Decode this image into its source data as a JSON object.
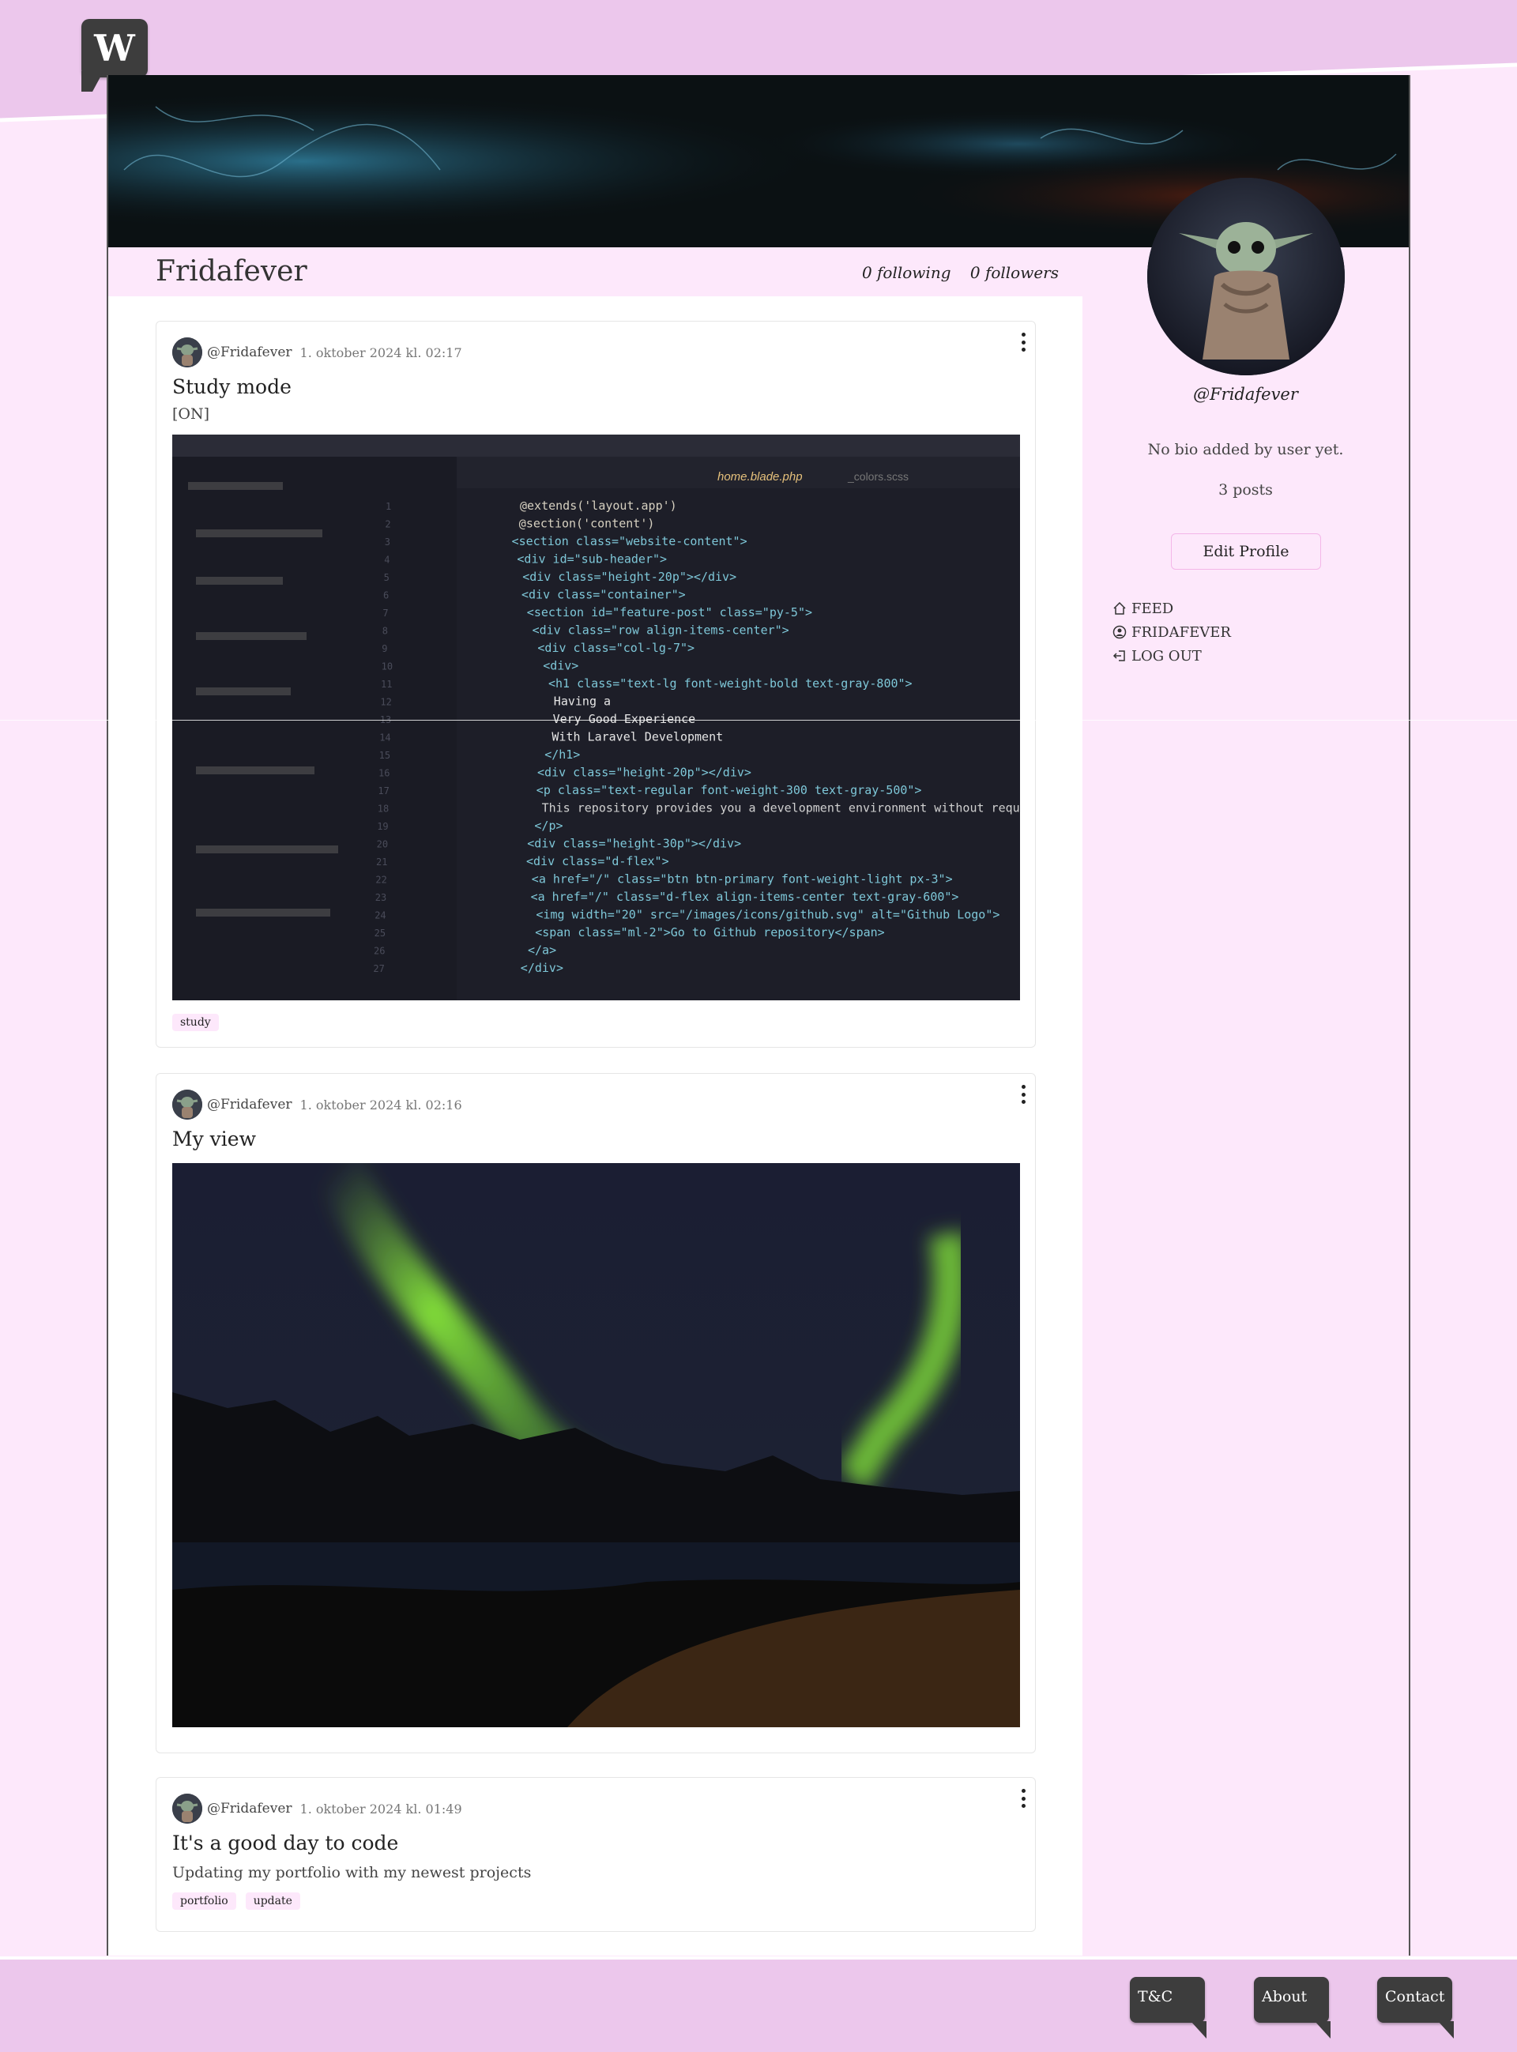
{
  "brand": {
    "logo_letter": "W"
  },
  "profile": {
    "name": "Fridafever",
    "following": "0 following",
    "followers": "0 followers",
    "handle": "@Fridafever",
    "bio": "No bio added by user yet.",
    "post_count": "3 posts",
    "edit_label": "Edit Profile"
  },
  "nav": {
    "feed": "FEED",
    "profile": "FRIDAFEVER",
    "logout": "LOG OUT"
  },
  "posts": [
    {
      "author": "@Fridafever",
      "date": "1. oktober 2024 kl. 02:17",
      "title": "Study mode",
      "body": "[ON]",
      "tags": [
        "study"
      ]
    },
    {
      "author": "@Fridafever",
      "date": "1. oktober 2024 kl. 02:16",
      "title": "My view",
      "body": "",
      "tags": []
    },
    {
      "author": "@Fridafever",
      "date": "1. oktober 2024 kl. 01:49",
      "title": "It's a good day to code",
      "body": "Updating my portfolio with my newest projects",
      "tags": [
        "portfolio",
        "update"
      ]
    }
  ],
  "code_image": {
    "tabs": [
      "home.blade.php",
      "_colors.scss"
    ],
    "lines": [
      "@extends('layout.app')",
      "@section('content')",
      "<section class=\"website-content\">",
      "<div id=\"sub-header\">",
      "<div class=\"height-20p\"></div>",
      "<div class=\"container\">",
      "<section id=\"feature-post\" class=\"py-5\">",
      "<div class=\"row align-items-center\">",
      "<div class=\"col-lg-7\">",
      "<div>",
      "<h1 class=\"text-lg font-weight-bold text-gray-800\">",
      "Having a",
      "Very Good Experience",
      "With Laravel Development",
      "</h1>",
      "<div class=\"height-20p\"></div>",
      "<p class=\"text-regular font-weight-300 text-gray-500\">",
      "This repository provides you a development environment without requ",
      "</p>",
      "<div class=\"height-30p\"></div>",
      "<div class=\"d-flex\">",
      "<a href=\"/\" class=\"btn btn-primary font-weight-light px-3\">",
      "<a href=\"/\" class=\"d-flex align-items-center text-gray-600\">",
      "<img width=\"20\" src=\"/images/icons/github.svg\" alt=\"Github Logo\">",
      "<span class=\"ml-2\">Go to Github repository</span>",
      "</a>",
      "</div>"
    ]
  },
  "footer": {
    "tc": "T&C",
    "about": "About",
    "contact": "Contact"
  },
  "colors": {
    "header": "#ecc7ec",
    "page": "#fde8fb",
    "dark": "#3d3d3d",
    "tag": "#fde8fb"
  }
}
